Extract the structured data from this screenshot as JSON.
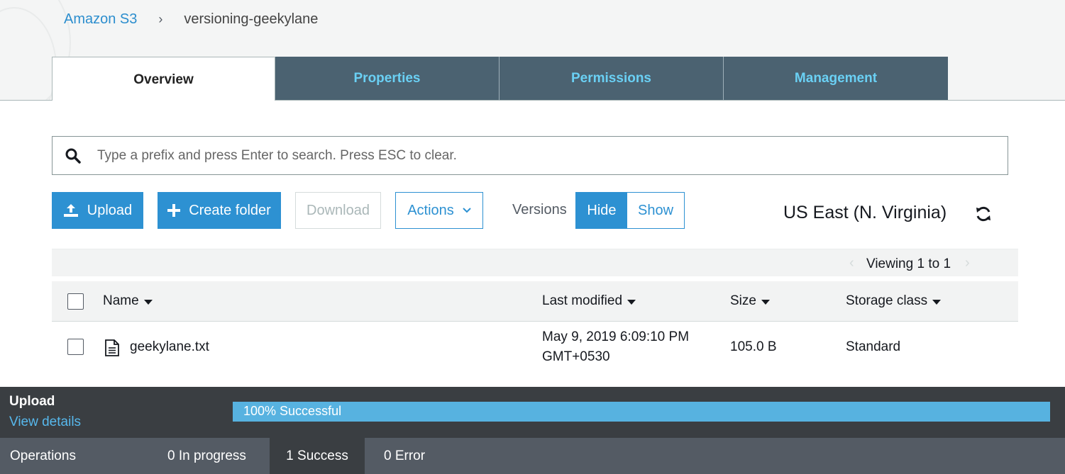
{
  "breadcrumb": {
    "root": "Amazon S3",
    "separator": "›",
    "current": "versioning-geekylane"
  },
  "tabs": [
    {
      "label": "Overview",
      "active": true
    },
    {
      "label": "Properties",
      "active": false
    },
    {
      "label": "Permissions",
      "active": false
    },
    {
      "label": "Management",
      "active": false
    }
  ],
  "search": {
    "placeholder": "Type a prefix and press Enter to search. Press ESC to clear."
  },
  "toolbar": {
    "upload": "Upload",
    "create_folder": "Create folder",
    "download": "Download",
    "actions": "Actions",
    "versions_label": "Versions",
    "hide": "Hide",
    "show": "Show",
    "region": "US East (N. Virginia)"
  },
  "pager": {
    "text": "Viewing 1 to 1"
  },
  "table": {
    "columns": [
      "Name",
      "Last modified",
      "Size",
      "Storage class"
    ],
    "rows": [
      {
        "name": "geekylane.txt",
        "modified_line1": "May 9, 2019 6:09:10 PM",
        "modified_line2": "GMT+0530",
        "size": "105.0 B",
        "storage_class": "Standard"
      }
    ]
  },
  "upload_panel": {
    "title": "Upload",
    "link": "View details",
    "progress_text": "100% Successful",
    "progress_fraction": 1.0
  },
  "operations": {
    "label": "Operations",
    "in_progress": "0 In progress",
    "success": "1 Success",
    "error": "0 Error"
  },
  "colors": {
    "accent": "#2d91d2",
    "tab_bg": "#4b6271",
    "tab_text": "#6ad0f4",
    "progress": "#57b2e0"
  },
  "icons": [
    "search-icon",
    "upload-icon",
    "plus-icon",
    "chevron-down-icon",
    "refresh-icon",
    "file-icon",
    "sort-caret-icon"
  ]
}
